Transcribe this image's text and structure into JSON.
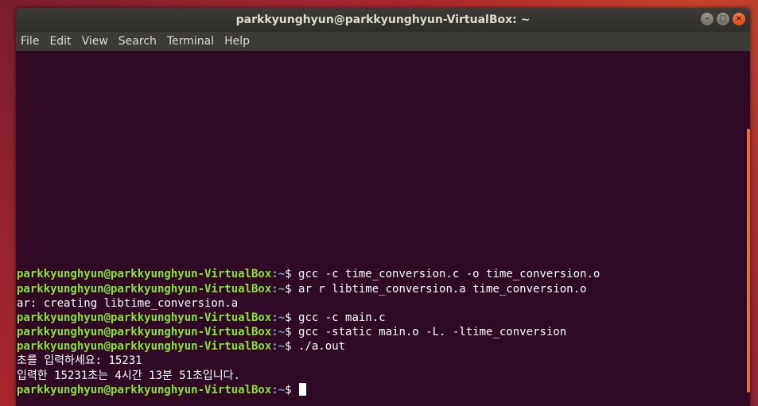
{
  "window": {
    "title": "parkkyunghyun@parkkyunghyun-VirtualBox: ~"
  },
  "controls": {
    "minimize": "–",
    "maximize": "□",
    "close": "×"
  },
  "menu": [
    "File",
    "Edit",
    "View",
    "Search",
    "Terminal",
    "Help"
  ],
  "prompt": {
    "user": "parkkyunghyun@parkkyunghyun-VirtualBox",
    "path": ":~",
    "symbol": "$ "
  },
  "lines": [
    {
      "type": "cmd",
      "text": "gcc -c time_conversion.c -o time_conversion.o"
    },
    {
      "type": "cmd",
      "text": "ar r libtime_conversion.a time_conversion.o"
    },
    {
      "type": "out",
      "text": "ar: creating libtime_conversion.a"
    },
    {
      "type": "cmd",
      "text": "gcc -c main.c"
    },
    {
      "type": "cmd",
      "text": "gcc -static main.o -L. -ltime_conversion"
    },
    {
      "type": "cmd",
      "text": "./a.out"
    },
    {
      "type": "out",
      "text": "초를 입력하세요: 15231"
    },
    {
      "type": "out",
      "text": "입력한 15231초는 4시간 13분 51초입니다."
    },
    {
      "type": "cmd",
      "text": "",
      "cursor": true
    }
  ],
  "colors": {
    "background": "#300a24",
    "prompt_user": "#8ae234",
    "prompt_path": "#729fcf",
    "scroll_thumb": "#e86f37"
  }
}
